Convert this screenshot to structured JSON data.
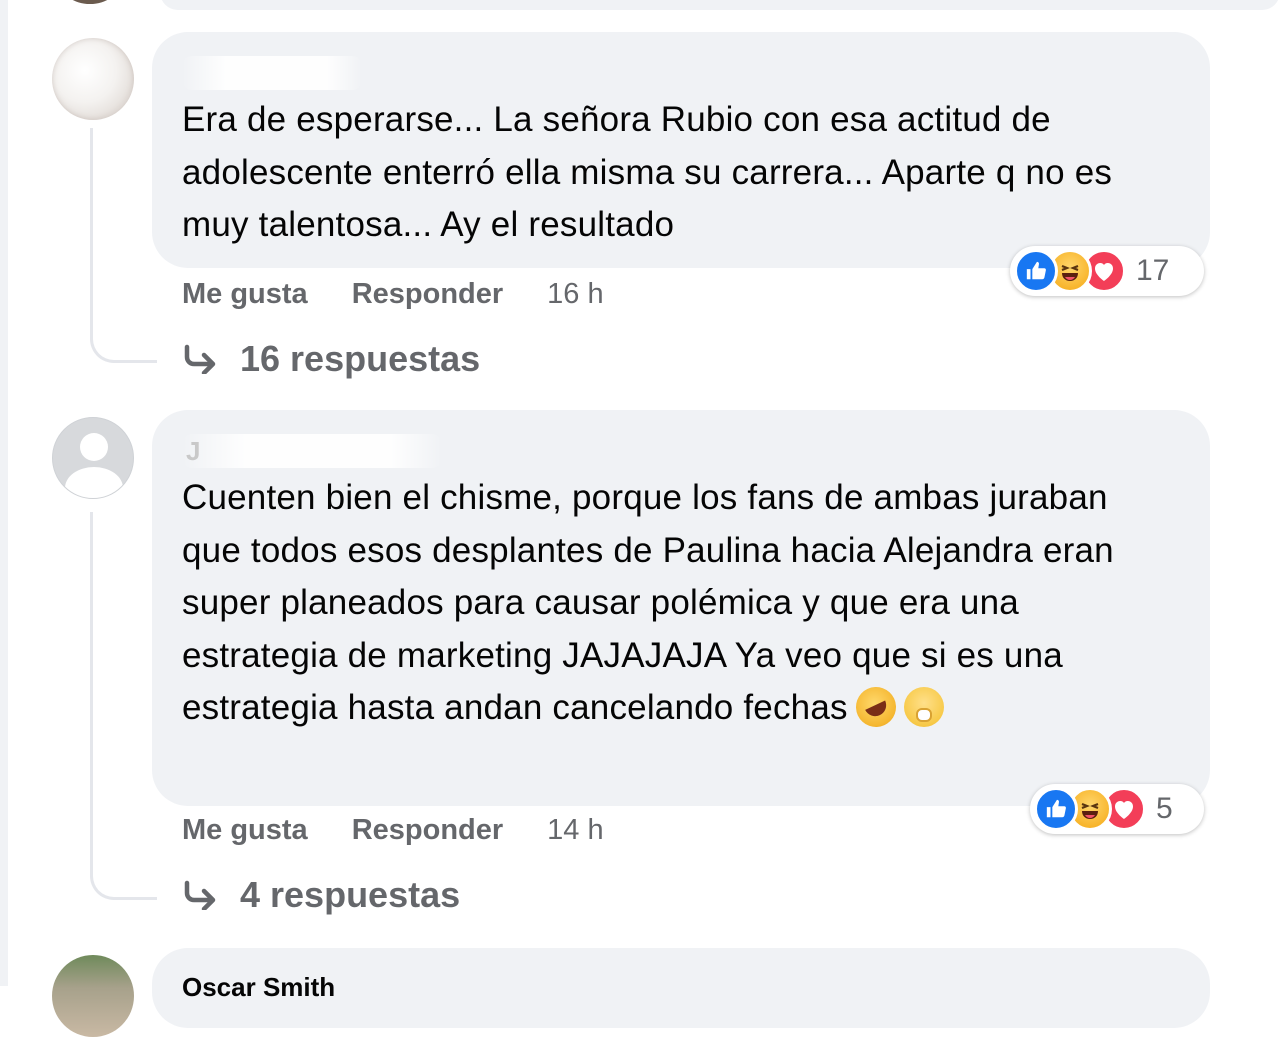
{
  "comments": [
    {
      "author": "",
      "text": "Era de esperarse... La señora Rubio con esa actitud de adolescente enterró ella misma su carrera... Aparte q no es muy talentosa... Ay el resultado",
      "reaction_count": "17",
      "like_label": "Me gusta",
      "reply_label": "Responder",
      "time": "16 h",
      "replies_label": "16 respuestas"
    },
    {
      "author": "J",
      "text": "Cuenten bien el chisme, porque los fans de ambas juraban que todos esos desplantes de Paulina hacia Alejandra eran super planeados para causar polémica y que era una estrategia de marketing JAJAJAJA Ya veo que si es una estrategia hasta andan cancelando fechas",
      "emojis": [
        "rolling-on-floor-laughing",
        "face-with-hand-over-mouth"
      ],
      "reaction_count": "5",
      "like_label": "Me gusta",
      "reply_label": "Responder",
      "time": "14 h",
      "replies_label": "4 respuestas"
    },
    {
      "author": "Oscar Smith"
    }
  ],
  "reaction_icons": [
    "like-icon",
    "haha-icon",
    "love-icon"
  ],
  "colors": {
    "bubble": "#f0f2f5",
    "secondary_text": "#65676b",
    "like_blue": "#1877f2",
    "love_red": "#f33e58"
  }
}
